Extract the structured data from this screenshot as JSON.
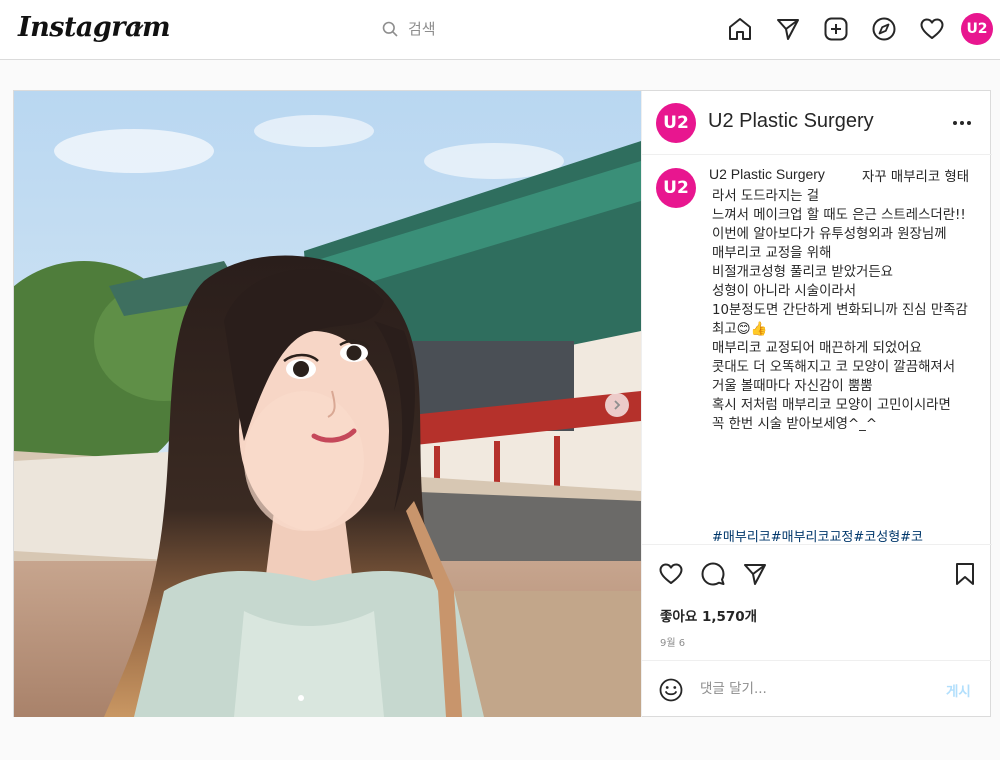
{
  "app": {
    "logo_text": "Instagram",
    "search_placeholder": "검색",
    "brand_color": "#e8168f",
    "nav_icons": [
      "home-icon",
      "direct-send-icon",
      "new-post-icon",
      "explore-compass-icon",
      "activity-heart-icon"
    ],
    "profile_avatar_text": "U2"
  },
  "post": {
    "account_name": "U2 Plastic Surgery",
    "avatar_text": "U2",
    "caption": "자꾸 매부리코 형태라서 도드라지는 걸\n느껴서 메이크업 할 때도 은근 스트레스더란!!\n이번에 알아보다가 유투성형외과 원장님께\n매부리코 교정을 위해\n비절개코성형 풀리코 받았거든요\n성형이 아니라 시술이라서\n10분정도면 간단하게 변화되니까 진심 만족감 최고😊👍\n매부리코 교정되어 매끈하게 되었어요\n콧대도 더 오똑해지고 코 모양이 깔끔해져서\n거울 볼때마다 자신감이 뿜뿜\n혹시 저처럼 매부리코 모양이 고민이시라면\n꼭 한번 시술 받아보세영^_^",
    "hashtags": "#매부리코#매부리코교정#코성형#코",
    "likes": "좋아요 1,570개",
    "date": "9월 6",
    "comment_placeholder": "댓글 달기...",
    "post_button": "게시",
    "carousel_total_dots": 1
  }
}
